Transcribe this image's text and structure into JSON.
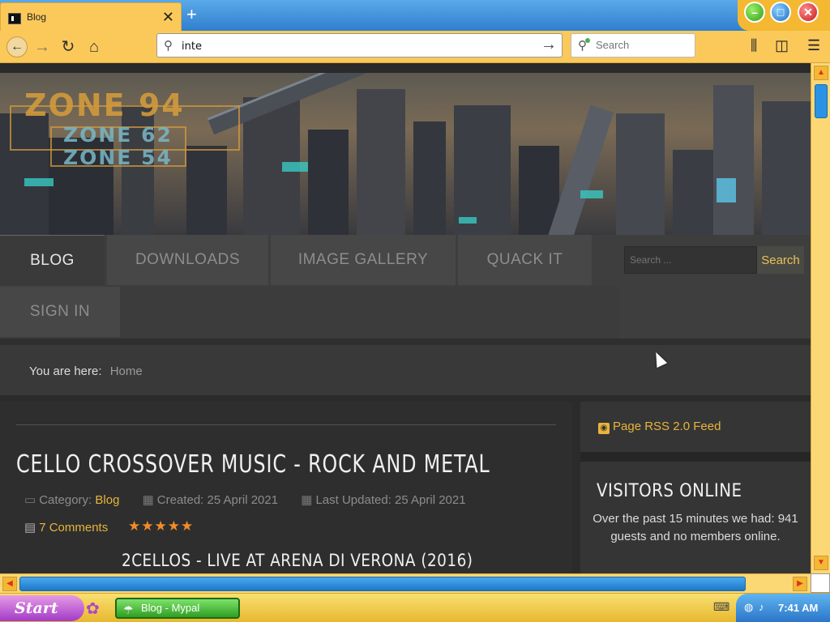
{
  "browser": {
    "tab_title": "Blog",
    "tab_close": "✕",
    "new_tab": "+",
    "url_value": "inte",
    "search_placeholder": "Search",
    "window_controls": [
      "minimize",
      "maximize",
      "close"
    ]
  },
  "site": {
    "logo_lines": [
      "ZONE 94",
      "ZONE 62",
      "ZONE 54"
    ],
    "menu": {
      "items": [
        "BLOG",
        "DOWNLOADS",
        "IMAGE GALLERY",
        "QUACK IT",
        "SIGN IN"
      ],
      "active": "BLOG"
    },
    "search": {
      "placeholder": "Search ...",
      "button": "Search"
    },
    "breadcrumb": {
      "prefix": "You are here:",
      "home": "Home"
    },
    "article": {
      "title": "CELLO CROSSOVER MUSIC - ROCK AND METAL",
      "category_label": "Category:",
      "category": "Blog",
      "created": "Created: 25 April 2021",
      "updated": "Last Updated: 25 April 2021",
      "comments": "7 Comments",
      "rating_stars": 5,
      "stars": "★★★★★",
      "subtitle": "2CELLOS - LIVE AT ARENA DI VERONA (2016)"
    },
    "sidebar": {
      "rss": "Page RSS 2.0 Feed",
      "visitors_title": "VISITORS ONLINE",
      "visitors_text": "Over the past 15 minutes we had: 941 guests and no members online."
    }
  },
  "taskbar": {
    "start": "Start",
    "task_label": "Blog - Mypal",
    "clock": "7:41 AM"
  }
}
